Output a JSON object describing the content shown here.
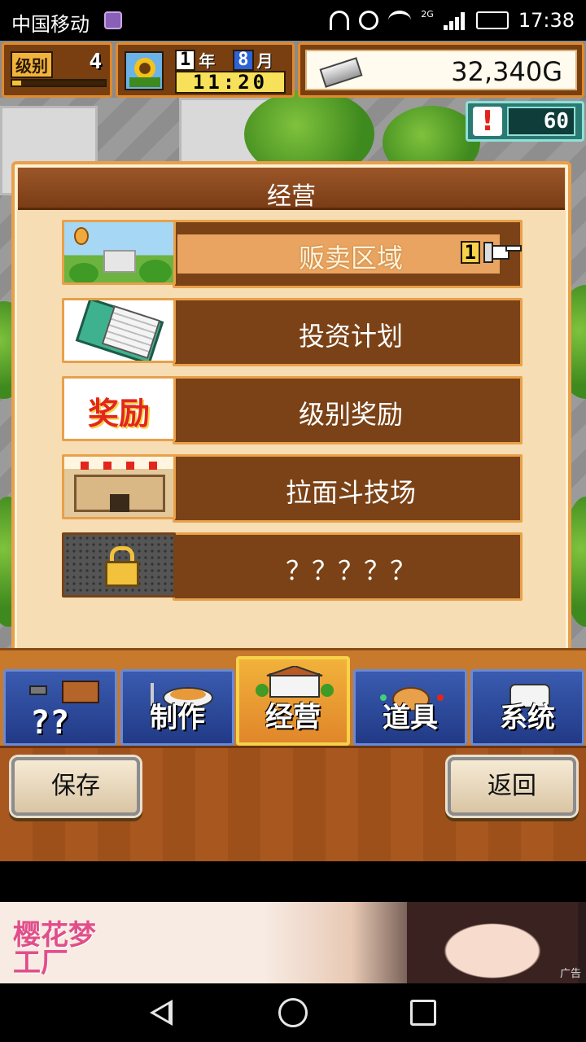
{
  "status_bar": {
    "carrier": "中国移动",
    "network": "2G",
    "time": "17:38",
    "icons": [
      "app-icon",
      "headphones-icon",
      "alarm-icon",
      "wifi-icon",
      "signal-icon",
      "battery-charging-icon"
    ]
  },
  "hud": {
    "level_label": "级别",
    "level_value": "4",
    "level_progress": 0.1,
    "year_value": "1",
    "year_unit": "年",
    "month_value": "8",
    "month_unit": "月",
    "clock": "11:20",
    "money": "32,340G",
    "alert_value": "60"
  },
  "panel": {
    "title": "经营",
    "items": [
      {
        "label": "贩卖区域",
        "badge": "1",
        "selected": true,
        "thumb": "sales-area"
      },
      {
        "label": "投资计划",
        "thumb": "invest"
      },
      {
        "label": "级别奖励",
        "thumb": "reward",
        "thumb_text": "奖励"
      },
      {
        "label": "拉面斗技场",
        "thumb": "arena"
      },
      {
        "label": "？？？？？",
        "thumb": "locked"
      }
    ]
  },
  "tabs": [
    {
      "label": "",
      "overlay": "??",
      "icon": "build-icon"
    },
    {
      "label": "制作",
      "icon": "cooking-icon"
    },
    {
      "label": "经营",
      "icon": "shop-icon",
      "active": true
    },
    {
      "label": "道具",
      "icon": "item-bag-icon"
    },
    {
      "label": "系统",
      "icon": "system-icon"
    }
  ],
  "buttons": {
    "save": "保存",
    "back": "返回"
  },
  "ad": {
    "logo": "樱花梦工厂",
    "tag": "广告"
  },
  "colors": {
    "panel_bg": "#f6ddb4",
    "item_bar": "#7a4216",
    "border_orange": "#e8a04a",
    "tab_blue": "#2c4a9e",
    "tab_active": "#f2b23a"
  }
}
